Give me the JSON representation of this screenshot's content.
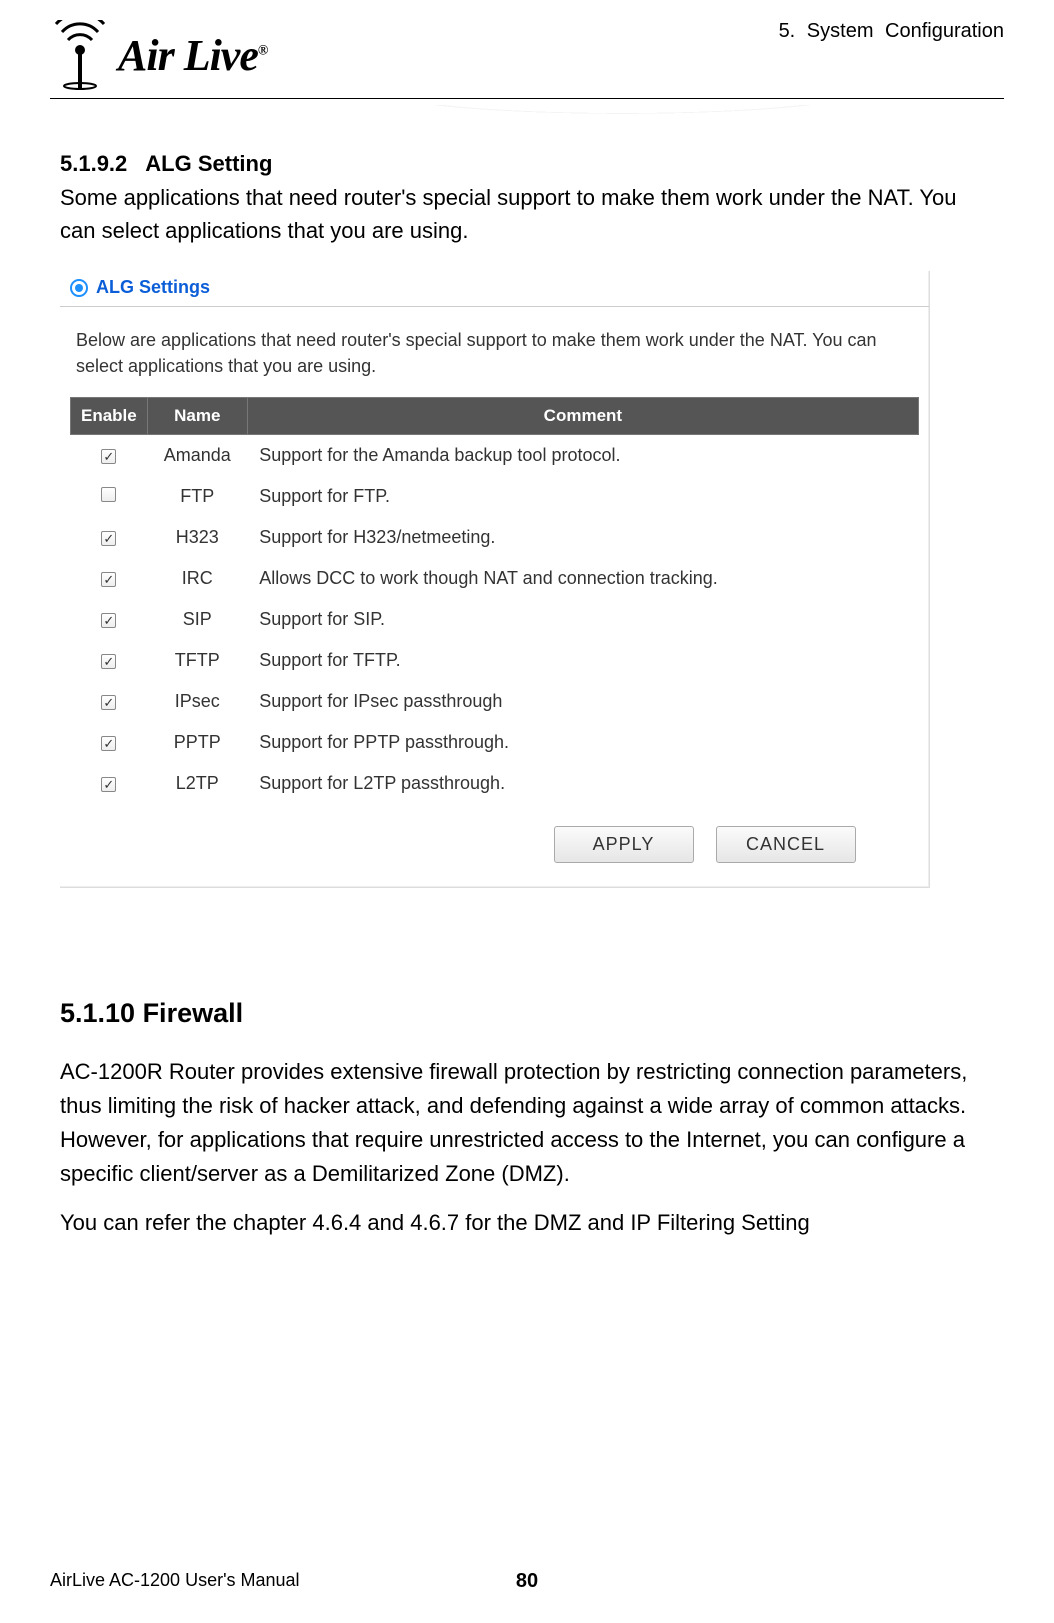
{
  "header": {
    "chapter": "5. System Configuration",
    "logo_text": "Air Live",
    "logo_reg": "®"
  },
  "section_alg": {
    "number": "5.1.9.2",
    "title": "ALG Setting",
    "intro": "Some applications that need router's special support to make them work under the NAT. You can select applications that you are using."
  },
  "screenshot": {
    "title": "ALG Settings",
    "intro": "Below are applications that need router's special support to make them work under the NAT. You can select applications that you are using.",
    "columns": {
      "enable": "Enable",
      "name": "Name",
      "comment": "Comment"
    },
    "rows": [
      {
        "enabled": true,
        "name": "Amanda",
        "comment": "Support for the Amanda backup tool protocol."
      },
      {
        "enabled": false,
        "name": "FTP",
        "comment": "Support for FTP."
      },
      {
        "enabled": true,
        "name": "H323",
        "comment": "Support for H323/netmeeting."
      },
      {
        "enabled": true,
        "name": "IRC",
        "comment": "Allows DCC to work though NAT and connection tracking."
      },
      {
        "enabled": true,
        "name": "SIP",
        "comment": "Support for SIP."
      },
      {
        "enabled": true,
        "name": "TFTP",
        "comment": "Support for TFTP."
      },
      {
        "enabled": true,
        "name": "IPsec",
        "comment": "Support for IPsec passthrough"
      },
      {
        "enabled": true,
        "name": "PPTP",
        "comment": "Support for PPTP passthrough."
      },
      {
        "enabled": true,
        "name": "L2TP",
        "comment": "Support for L2TP passthrough."
      }
    ],
    "buttons": {
      "apply": "APPLY",
      "cancel": "CANCEL"
    }
  },
  "section_firewall": {
    "heading": "5.1.10 Firewall",
    "p1": "AC-1200R Router provides extensive firewall protection by restricting connection parameters, thus limiting the risk of hacker attack, and defending against a wide array of common attacks. However, for applications that require unrestricted access to the Internet, you can configure a specific client/server as a Demilitarized Zone (DMZ).",
    "p2": "You can refer the chapter 4.6.4 and 4.6.7 for the DMZ and IP Filtering Setting"
  },
  "footer": {
    "manual": "AirLive AC-1200 User's Manual",
    "page": "80"
  }
}
